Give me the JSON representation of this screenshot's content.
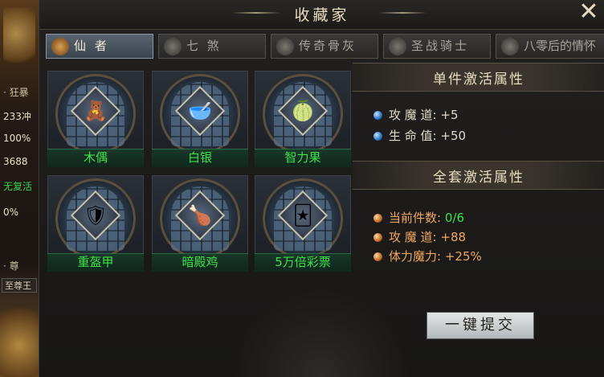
{
  "left_edge": {
    "lines": [
      "· 狂暴",
      "233冲",
      "100%",
      "3688",
      "无复活",
      "0%",
      "· 尊",
      "至尊王"
    ]
  },
  "window": {
    "title": "收藏家",
    "close_icon": "close-x-icon"
  },
  "tabs": [
    {
      "label": "仙 者",
      "icon": "lantern-icon",
      "active": true
    },
    {
      "label": "七 煞",
      "icon": "demon-mask-icon",
      "active": false
    },
    {
      "label": "传奇骨灰",
      "icon": "urn-icon",
      "active": false
    },
    {
      "label": "圣战骑士",
      "icon": "knight-helm-icon",
      "active": false
    },
    {
      "label": "八零后的情怀",
      "icon": "sword-icon",
      "active": false
    }
  ],
  "items": [
    {
      "name": "木偶",
      "icon": "puppet-icon",
      "glyph": "🧸"
    },
    {
      "name": "白银",
      "icon": "silver-ingot-icon",
      "glyph": "🥣"
    },
    {
      "name": "智力果",
      "icon": "wisdom-fruit-icon",
      "glyph": "🍈"
    },
    {
      "name": "重盔甲",
      "icon": "heavy-armor-icon",
      "glyph": "🛡"
    },
    {
      "name": "暗殿鸡",
      "icon": "roast-chicken-icon",
      "glyph": "🍗"
    },
    {
      "name": "5万倍彩票",
      "icon": "lottery-cards-icon",
      "glyph": "🃏"
    }
  ],
  "single_attrs": {
    "title": "单件激活属性",
    "list": [
      {
        "label": "攻 魔 道:",
        "value": "+5"
      },
      {
        "label": "生 命 值:",
        "value": "+50"
      }
    ]
  },
  "set_attrs": {
    "title": "全套激活属性",
    "list": [
      {
        "label": "当前件数:",
        "value": "0/6"
      },
      {
        "label": "攻 魔 道:",
        "value": "+88"
      },
      {
        "label": "体力魔力:",
        "value": "+25%"
      }
    ]
  },
  "submit_label": "一键提交",
  "colors": {
    "item_name": "#3fe04a",
    "set_attr": "#f0a860",
    "active_tab": "#5a6470"
  }
}
